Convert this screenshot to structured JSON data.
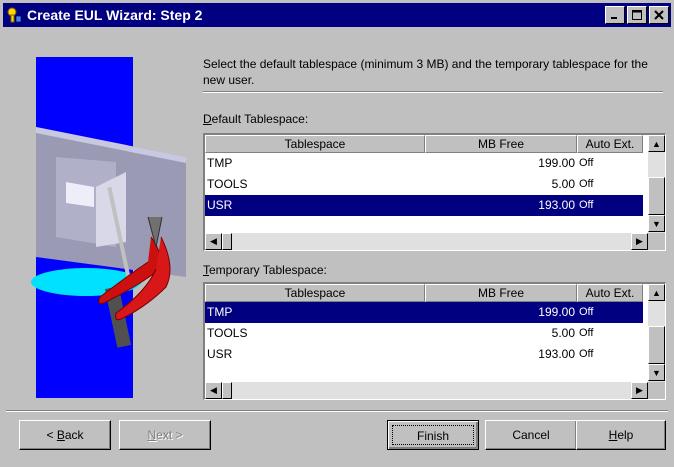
{
  "window": {
    "title": "Create EUL Wizard: Step 2",
    "controls": [
      "minimize-icon",
      "maximize-icon",
      "close-icon"
    ]
  },
  "instructions": "Select the default tablespace (minimum 3 MB) and the temporary tablespace for the new user.",
  "default_tablespace": {
    "label_underlined": "D",
    "label_rest": "efault Tablespace:",
    "columns": [
      "Tablespace",
      "MB Free",
      "Auto Ext."
    ],
    "rows": [
      {
        "name": "TMP",
        "mb_free": "199.00",
        "auto_ext": "Off"
      },
      {
        "name": "TOOLS",
        "mb_free": "5.00",
        "auto_ext": "Off"
      },
      {
        "name": "USR",
        "mb_free": "193.00",
        "auto_ext": "Off"
      }
    ],
    "selected_row": "USR"
  },
  "temporary_tablespace": {
    "label_underlined": "T",
    "label_rest": "emporary Tablespace:",
    "columns": [
      "Tablespace",
      "MB Free",
      "Auto Ext."
    ],
    "rows": [
      {
        "name": "TMP",
        "mb_free": "199.00",
        "auto_ext": "Off"
      },
      {
        "name": "TOOLS",
        "mb_free": "5.00",
        "auto_ext": "Off"
      },
      {
        "name": "USR",
        "mb_free": "193.00",
        "auto_ext": "Off"
      }
    ],
    "selected_row": "TMP"
  },
  "buttons": {
    "back_prefix": "< ",
    "back_underlined": "B",
    "back_rest": "ack",
    "next_underlined": "N",
    "next_rest": "ext >",
    "finish": "Finish",
    "cancel": "Cancel",
    "help_underlined": "H",
    "help_rest": "elp"
  },
  "colors": {
    "title_bar": "#000080",
    "selection": "#000080",
    "art_background": "#0000ff",
    "face": "#c0c0c0"
  }
}
